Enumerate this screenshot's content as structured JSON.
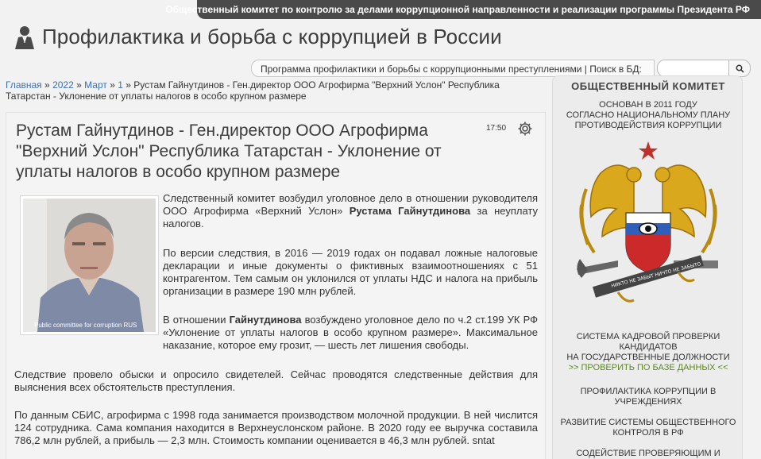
{
  "topbar": {
    "text": "Общественный комитет по контролю за делами коррупционной направленности и реализации программы Президента РФ"
  },
  "site": {
    "title": "Профилактика и борьба с коррупцией в России",
    "logo_icon": "person-icon"
  },
  "program_bar": {
    "text": "Программа профилактики и борьбы с коррупционными преступлениями | Поиск в БД:"
  },
  "search": {
    "placeholder": "",
    "icon": "search-icon"
  },
  "breadcrumb": {
    "items": [
      "Главная",
      "2022",
      "Март",
      "1"
    ],
    "separator": "»",
    "current": "Рустам Гайнутдинов - Ген.директор ООО Агрофирма \"Верхний Услон\" Республика Татарстан - Уклонение от уплаты налогов в особо крупном размере"
  },
  "article": {
    "title": "Рустам Гайнутдинов - Ген.директор ООО Агрофирма \"Верхний Услон\" Республика Татарстан - Уклонение от уплаты налогов в особо крупном размере",
    "time": "17:50",
    "photo_caption": "Public committee for corruption RUS",
    "p1_a": "Следственный комитет возбудил уголовное дело в отношении руководителя ООО Агрофирма «Верхний Услон» ",
    "p1_b": "Рустама Гайнутдинова",
    "p1_c": " за неуплату налогов.",
    "p2": "По версии следствия, в 2016 — 2019 годах он подавал ложные налоговые декларации и иные документы о фиктивных взаимоотношениях с 51 контрагентом. Тем самым он уклонился от уплаты НДС и налога на прибыль организации в размере 190 млн рублей.",
    "p3_a": "В отношении ",
    "p3_b": "Гайнутдинова",
    "p3_c": " возбуждено уголовное дело по ч.2 ст.199 УК РФ «Уклонение от уплаты налогов в особо крупном размере». Максимальное наказание, которое ему грозит, — шесть лет лишения свободы.",
    "p4": "Следствие провело обыски и опросило свидетелей. Сейчас проводятся следственные действия для выяснения всех обстоятельств преступления.",
    "p5": "По данным СБИС, агрофирма с 1998 года занимается производством молочной продукции. В ней числится 124 сотрудника. Сама компания находится в Верхнеуслонском районе. В 2020 году ее выручка составила 786,2 млн рублей, а прибыль — 2,3 млн. Стоимость компании оценивается в 46,3 млн рублей.  sntat"
  },
  "sidebar": {
    "heading": "ОБЩЕСТВЕННЫЙ КОМИТЕТ",
    "founded": "ОСНОВАН В 2011 ГОДУ",
    "plan_1": "СОГЛАСНО НАЦИОНАЛЬНОМУ ПЛАНУ",
    "plan_2": "ПРОТИВОДЕЙСТВИЯ КОРРУПЦИИ",
    "emblem_ribbon": "НИКТО НЕ ЗАБЫТ НИЧТО НЕ ЗАБЫТО",
    "check_1": "СИСТЕМА КАДРОВОЙ ПРОВЕРКИ",
    "check_2": "КАНДИДАТОВ",
    "check_3": "НА ГОСУДАРСТВЕННЫЕ ДОЛЖНОСТИ",
    "check_link": ">> ПРОВЕРИТЬ ПО БАЗЕ ДАННЫХ <<",
    "prof_1": "ПРОФИЛАКТИКА КОРРУПЦИИ В",
    "prof_2": "УЧРЕЖДЕНИЯХ",
    "dev_1": "РАЗВИТИЕ СИСТЕМЫ ОБЩЕСТВЕННОГО",
    "dev_2": "КОНТРОЛЯ В РФ",
    "assist": "СОДЕЙСТВИЕ ПРОВЕРЯЮЩИМ И"
  },
  "colors": {
    "topbar_bg": "#4a4a4a",
    "link": "#3a6fb5",
    "sidebar_link": "#5a8a1a"
  }
}
